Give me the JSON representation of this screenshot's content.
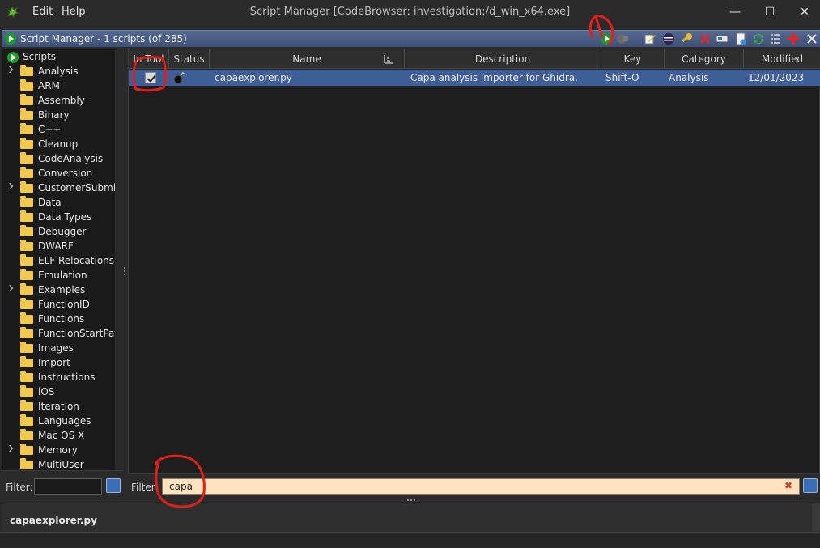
{
  "window": {
    "title": "Script Manager [CodeBrowser: investigation:/d_win_x64.exe]",
    "menu": [
      "Edit",
      "Help"
    ],
    "controls": {
      "minimize": "—",
      "maximize": "☐",
      "close": "✕"
    }
  },
  "panel": {
    "title": "Script Manager - 1 scripts  (of 285)"
  },
  "tree": {
    "root": "Scripts",
    "items": [
      {
        "label": "Analysis",
        "expandable": true
      },
      {
        "label": "ARM",
        "expandable": false
      },
      {
        "label": "Assembly",
        "expandable": false
      },
      {
        "label": "Binary",
        "expandable": false
      },
      {
        "label": "C++",
        "expandable": false
      },
      {
        "label": "Cleanup",
        "expandable": false
      },
      {
        "label": "CodeAnalysis",
        "expandable": false
      },
      {
        "label": "Conversion",
        "expandable": false
      },
      {
        "label": "CustomerSubmiss",
        "expandable": true
      },
      {
        "label": "Data",
        "expandable": false
      },
      {
        "label": "Data Types",
        "expandable": false
      },
      {
        "label": "Debugger",
        "expandable": false
      },
      {
        "label": "DWARF",
        "expandable": false
      },
      {
        "label": "ELF Relocations",
        "expandable": false
      },
      {
        "label": "Emulation",
        "expandable": false
      },
      {
        "label": "Examples",
        "expandable": true
      },
      {
        "label": "FunctionID",
        "expandable": false
      },
      {
        "label": "Functions",
        "expandable": false
      },
      {
        "label": "FunctionStartPatte",
        "expandable": false
      },
      {
        "label": "Images",
        "expandable": false
      },
      {
        "label": "Import",
        "expandable": false
      },
      {
        "label": "Instructions",
        "expandable": false
      },
      {
        "label": "iOS",
        "expandable": false
      },
      {
        "label": "Iteration",
        "expandable": false
      },
      {
        "label": "Languages",
        "expandable": false
      },
      {
        "label": "Mac OS X",
        "expandable": false
      },
      {
        "label": "Memory",
        "expandable": true
      },
      {
        "label": "MultiUser",
        "expandable": false
      }
    ]
  },
  "table": {
    "columns": {
      "tool": "In Tool",
      "status": "Status",
      "name": "Name",
      "description": "Description",
      "key": "Key",
      "category": "Category",
      "modified": "Modified"
    },
    "rows": [
      {
        "in_tool": true,
        "name": "capaexplorer.py",
        "description": "Capa analysis importer for Ghidra.",
        "key": "Shift-O",
        "category": "Analysis",
        "modified": "12/01/2023"
      }
    ]
  },
  "filters": {
    "left_label": "Filter:",
    "left_value": "",
    "right_label": "Filter:",
    "right_value": "capa"
  },
  "info": {
    "selected_script": "capaexplorer.py"
  },
  "colors": {
    "selection": "#3f5d96",
    "panel_header": "#4b5f87",
    "filter_bg": "#fce3bd",
    "annotation": "#e0201b"
  }
}
